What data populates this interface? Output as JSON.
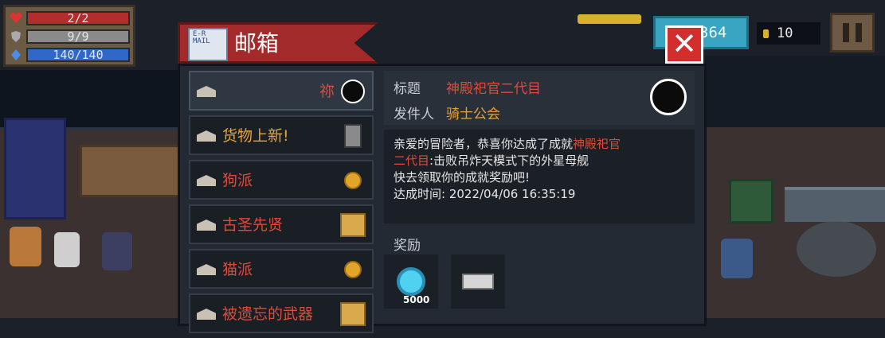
{
  "hud": {
    "hp": "2/2",
    "armor": "9/9",
    "energy": "140/140",
    "gems": "364",
    "coins": "10"
  },
  "mailbox": {
    "title": "邮箱",
    "icon_text": "E-R\nMAIL",
    "close_label": "✕"
  },
  "mail_list": [
    {
      "name": "祢",
      "color": "#e04a3a",
      "thumb": "avatar"
    },
    {
      "name": "货物上新!",
      "color": "#e8a23a",
      "thumb": "npc"
    },
    {
      "name": "狗派",
      "color": "#e04a3a",
      "thumb": "coin"
    },
    {
      "name": "古圣先贤",
      "color": "#e04a3a",
      "thumb": "scroll"
    },
    {
      "name": "猫派",
      "color": "#e04a3a",
      "thumb": "coin"
    },
    {
      "name": "被遗忘的武器",
      "color": "#e04a3a",
      "thumb": "scroll"
    }
  ],
  "detail": {
    "subject_label": "标题",
    "subject_value": "神殿祀官二代目",
    "sender_label": "发件人",
    "sender_value": "骑士公会",
    "body_line1_prefix": "亲爱的冒险者，恭喜你达成了成就",
    "body_line1_highlight": "神殿祀官",
    "body_line2_highlight": "二代目",
    "body_line2_suffix": ":击败吊炸天模式下的外星母舰",
    "body_line3": "快去领取你的成就奖励吧!",
    "body_line4": "达成时间: 2022/04/06 16:35:19",
    "rewards_label": "奖励",
    "reward_gem_count": "5000"
  }
}
